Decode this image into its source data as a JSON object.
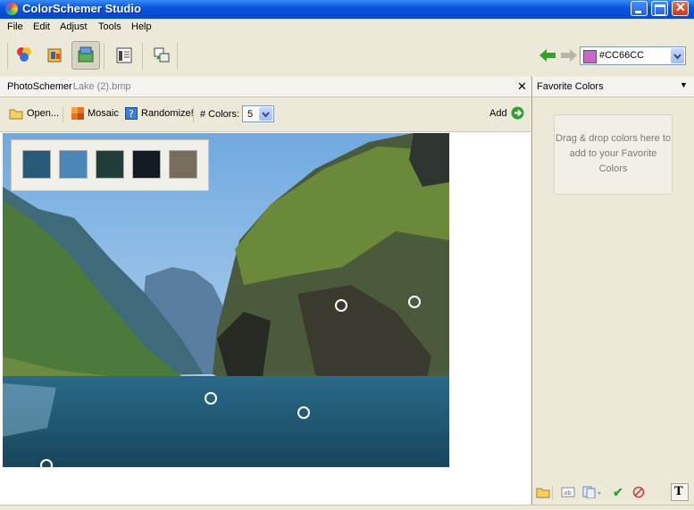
{
  "window": {
    "title": "ColorSchemer Studio"
  },
  "menu": [
    "File",
    "Edit",
    "Adjust",
    "Tools",
    "Help"
  ],
  "toolbar": {
    "icons": [
      "color-wheel-icon",
      "palette-icon",
      "photo-schemer-icon",
      "gallery-icon",
      "print-icon"
    ],
    "current_color": "#CC66CC",
    "current_color_hex": "#cc66cc"
  },
  "photo_panel": {
    "title": "PhotoSchemer",
    "file": " - Lake (2).bmp",
    "open_label": "Open...",
    "mosaic_label": "Mosaic",
    "randomize_label": "Randomize!",
    "colors_label": "# Colors:",
    "colors_value": "5",
    "add_label": "Add"
  },
  "palette": [
    "#265a78",
    "#4a86b8",
    "#213d3a",
    "#131b22",
    "#766d5c"
  ],
  "favorites": {
    "title": "Favorite Colors",
    "hint": "Drag & drop colors here to add to your Favorite Colors"
  }
}
